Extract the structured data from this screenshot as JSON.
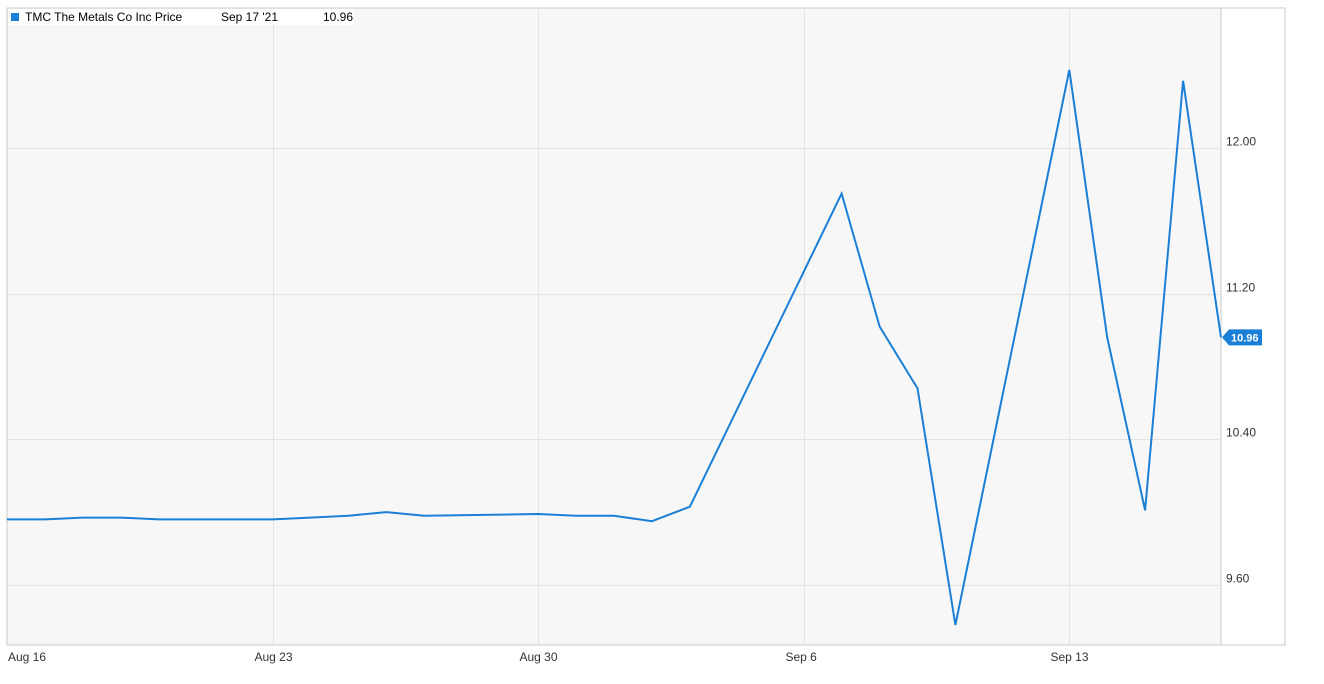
{
  "legend": {
    "series_name": "TMC The Metals Co Inc Price",
    "date_label": "Sep 17 '21",
    "value_label": "10.96"
  },
  "current_price_label": "10.96",
  "colors": {
    "line": "#1a7fd6",
    "legend_square": "#1a7fd6",
    "plot_background": "#f7f7f7",
    "grid": "#e3e3e3",
    "axis": "#c8c8c8",
    "badge": "#1a7fd6"
  },
  "chart_data": {
    "type": "line",
    "title": "",
    "xlabel": "",
    "ylabel": "",
    "grid": true,
    "legend_position": "top-left",
    "y_axis_position": "right",
    "ylim": [
      9.27,
      12.77
    ],
    "xlim": [
      "Aug 16",
      "Sep 17"
    ],
    "x_ticks": [
      "Aug 16",
      "Aug 23",
      "Aug 30",
      "Sep 6",
      "Sep 13"
    ],
    "y_ticks": [
      "12.00",
      "11.20",
      "10.40",
      "9.60"
    ],
    "series": [
      {
        "name": "TMC The Metals Co Inc Price",
        "points": [
          {
            "x": "Aug 16",
            "y": 9.96
          },
          {
            "x": "Aug 17",
            "y": 9.96
          },
          {
            "x": "Aug 18",
            "y": 9.97
          },
          {
            "x": "Aug 19",
            "y": 9.97
          },
          {
            "x": "Aug 20",
            "y": 9.96
          },
          {
            "x": "Aug 23",
            "y": 9.96
          },
          {
            "x": "Aug 24",
            "y": 9.97
          },
          {
            "x": "Aug 25",
            "y": 9.98
          },
          {
            "x": "Aug 26",
            "y": 10.0
          },
          {
            "x": "Aug 27",
            "y": 9.98
          },
          {
            "x": "Aug 30",
            "y": 9.99
          },
          {
            "x": "Aug 31",
            "y": 9.98
          },
          {
            "x": "Sep 1",
            "y": 9.98
          },
          {
            "x": "Sep 2",
            "y": 9.95
          },
          {
            "x": "Sep 3",
            "y": 10.03
          },
          {
            "x": "Sep 7",
            "y": 11.75
          },
          {
            "x": "Sep 8",
            "y": 11.02
          },
          {
            "x": "Sep 9",
            "y": 10.68
          },
          {
            "x": "Sep 10",
            "y": 9.38
          },
          {
            "x": "Sep 13",
            "y": 12.43
          },
          {
            "x": "Sep 14",
            "y": 10.96
          },
          {
            "x": "Sep 15",
            "y": 10.01
          },
          {
            "x": "Sep 16",
            "y": 12.37
          },
          {
            "x": "Sep 17",
            "y": 10.96
          }
        ]
      }
    ]
  }
}
